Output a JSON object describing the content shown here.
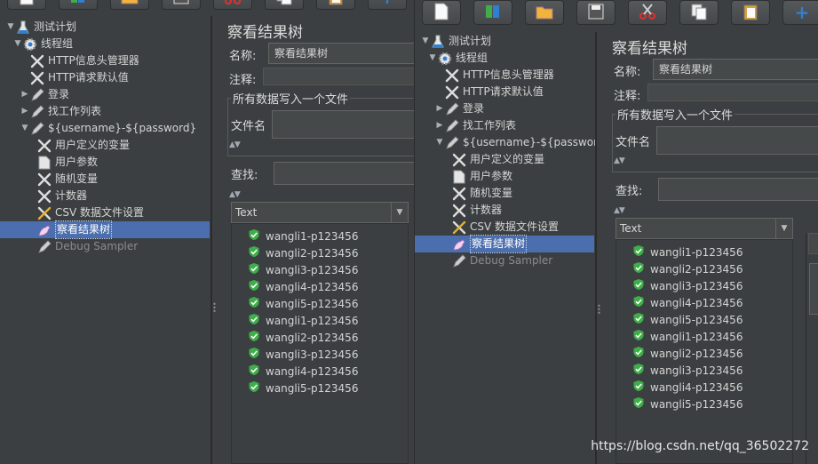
{
  "colors": {
    "bg": "#3c3f41",
    "selection": "#4b6eaf",
    "check": "#3fae49",
    "accent_blue": "#2f7fd3"
  },
  "toolbar": {
    "icons": [
      "new-icon",
      "templates-icon",
      "open-icon",
      "save-icon",
      "cut-icon",
      "copy-icon",
      "paste-icon",
      "add-icon"
    ],
    "add_symbol": "+"
  },
  "tree": {
    "items": [
      {
        "label": "测试计划",
        "icon": "flask-icon",
        "level": 0,
        "arrow": "▼"
      },
      {
        "label": "线程组",
        "icon": "gear-icon",
        "level": 1,
        "arrow": "▼"
      },
      {
        "label": "HTTP信息头管理器",
        "icon": "wrench-icon",
        "level": 2,
        "arrow": ""
      },
      {
        "label": "HTTP请求默认值",
        "icon": "wrench-icon",
        "level": 2,
        "arrow": ""
      },
      {
        "label": "登录",
        "icon": "pen-icon",
        "level": 2,
        "arrow": "▶"
      },
      {
        "label": "找工作列表",
        "icon": "pen-icon",
        "level": 2,
        "arrow": "▶"
      },
      {
        "label": "${username}-${password}",
        "icon": "pen-icon",
        "level": 2,
        "arrow": "▼"
      },
      {
        "label": "用户定义的变量",
        "icon": "wrench-icon",
        "level": 3,
        "arrow": ""
      },
      {
        "label": "用户参数",
        "icon": "doc-icon",
        "level": 3,
        "arrow": ""
      },
      {
        "label": "随机变量",
        "icon": "wrench-icon",
        "level": 3,
        "arrow": ""
      },
      {
        "label": "计数器",
        "icon": "wrench-icon",
        "level": 3,
        "arrow": ""
      },
      {
        "label": "CSV 数据文件设置",
        "icon": "csv-wrench-icon",
        "level": 3,
        "arrow": ""
      },
      {
        "label": "察看结果树",
        "icon": "listener-icon",
        "level": 3,
        "arrow": "",
        "selected": true
      },
      {
        "label": "Debug Sampler",
        "icon": "pen-icon",
        "level": 3,
        "arrow": "",
        "dim": true
      }
    ]
  },
  "panel": {
    "title": "察看结果树",
    "name_label": "名称:",
    "name_value": "察看结果树",
    "comment_label": "注释:",
    "group_title": "所有数据写入一个文件",
    "filename_label": "文件名",
    "search_label": "查找:",
    "renderer": "Text"
  },
  "results": [
    "wangli1-p123456",
    "wangli2-p123456",
    "wangli3-p123456",
    "wangli4-p123456",
    "wangli5-p123456",
    "wangli1-p123456",
    "wangli2-p123456",
    "wangli3-p123456",
    "wangli4-p123456",
    "wangli5-p123456"
  ],
  "watermark": "https://blog.csdn.net/qq_36502272"
}
